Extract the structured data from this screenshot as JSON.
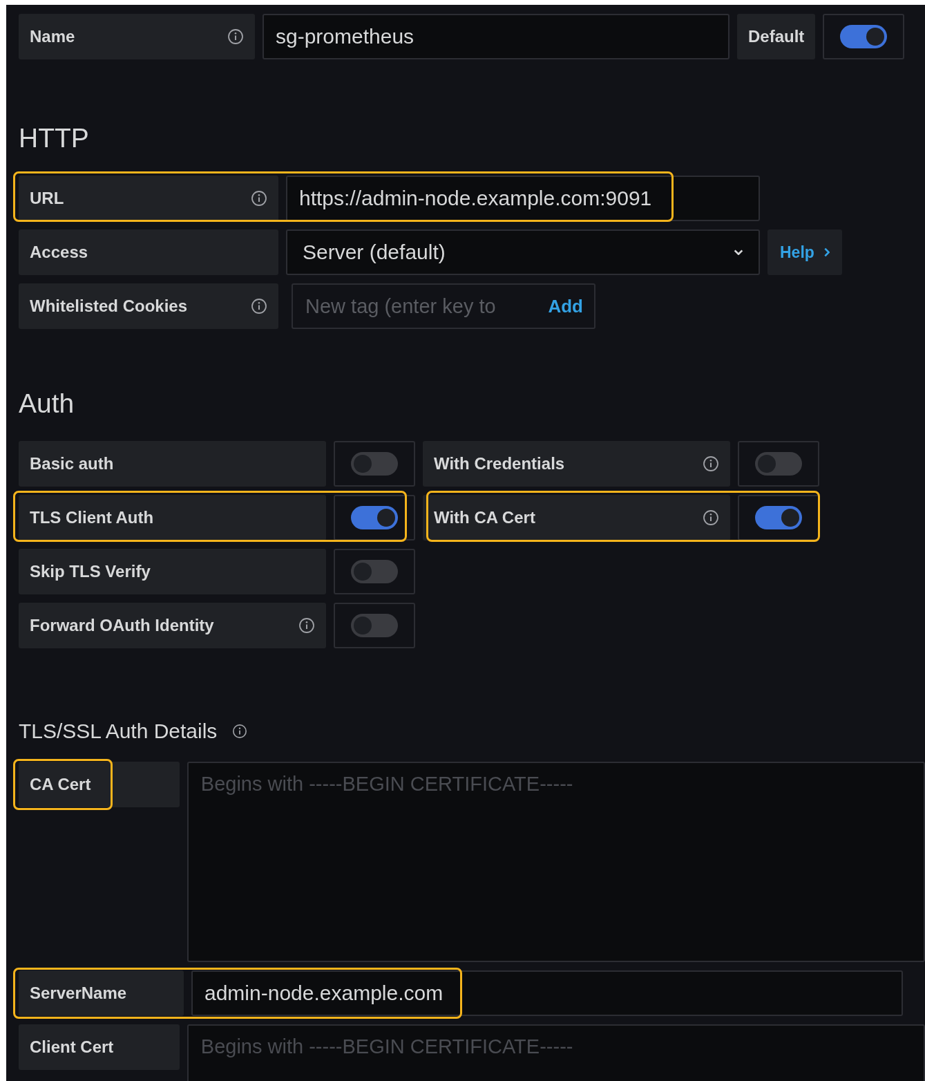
{
  "name_row": {
    "label": "Name",
    "value": "sg-prometheus",
    "default_label": "Default",
    "default_on": true
  },
  "http": {
    "heading": "HTTP",
    "fields": [
      {
        "kind": "input",
        "label": "URL",
        "info": true,
        "value": "https://admin-node.example.com:9091",
        "highlighted": true
      },
      {
        "kind": "select",
        "label": "Access",
        "info": false,
        "value": "Server (default)",
        "help": "Help",
        "highlighted": false
      },
      {
        "kind": "tags",
        "label": "Whitelisted Cookies",
        "info": true,
        "placeholder": "New tag (enter key to",
        "add": "Add",
        "highlighted": false
      }
    ]
  },
  "auth": {
    "heading": "Auth",
    "rows": [
      {
        "left": {
          "label": "Basic auth",
          "info": false,
          "on": false,
          "highlighted": false
        },
        "right": {
          "label": "With Credentials",
          "info": true,
          "on": false,
          "highlighted": false
        }
      },
      {
        "left": {
          "label": "TLS Client Auth",
          "info": false,
          "on": true,
          "highlighted": true
        },
        "right": {
          "label": "With CA Cert",
          "info": true,
          "on": true,
          "highlighted": true
        }
      },
      {
        "left": {
          "label": "Skip TLS Verify",
          "info": false,
          "on": false,
          "highlighted": false
        }
      },
      {
        "left": {
          "label": "Forward OAuth Identity",
          "info": true,
          "on": false,
          "highlighted": false
        }
      }
    ]
  },
  "tls": {
    "heading": "TLS/SSL Auth Details",
    "info": true,
    "fields": [
      {
        "kind": "textarea",
        "label": "CA Cert",
        "placeholder": "Begins with -----BEGIN CERTIFICATE-----",
        "highlighted": true
      },
      {
        "kind": "input",
        "label": "ServerName",
        "value": "admin-node.example.com",
        "highlighted": true
      },
      {
        "kind": "textarea",
        "label": "Client Cert",
        "placeholder": "Begins with -----BEGIN CERTIFICATE-----",
        "highlighted": false
      }
    ]
  }
}
